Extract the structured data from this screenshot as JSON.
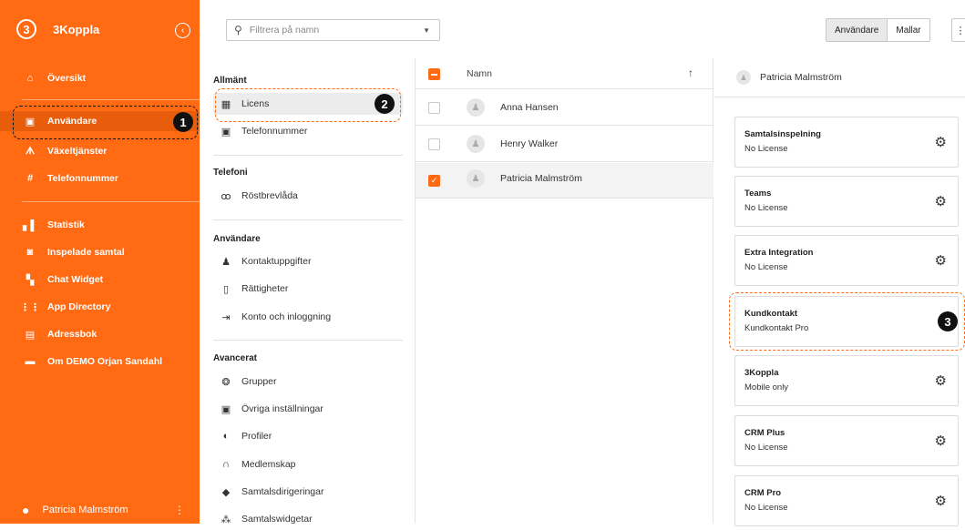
{
  "sidebar": {
    "app_title": "3Koppla",
    "logo_glyph": "3",
    "collapse_glyph": "‹",
    "items": [
      {
        "label": "Översikt",
        "icon": "home-icon",
        "glyph": "⌂"
      },
      {
        "label": "Användare",
        "icon": "user-card-icon",
        "glyph": "▣"
      },
      {
        "label": "Växeltjänster",
        "icon": "hierarchy-icon",
        "glyph": "ᗑ"
      },
      {
        "label": "Telefonnummer",
        "icon": "hash-icon",
        "glyph": "#"
      },
      {
        "label": "Statistik",
        "icon": "bar-chart-icon",
        "glyph": "▖▌"
      },
      {
        "label": "Inspelade samtal",
        "icon": "voicemail-icon",
        "glyph": "◙"
      },
      {
        "label": "Chat Widget",
        "icon": "widgets-icon",
        "glyph": "▚"
      },
      {
        "label": "App Directory",
        "icon": "grid-icon",
        "glyph": "⋮⋮"
      },
      {
        "label": "Adressbok",
        "icon": "contacts-icon",
        "glyph": "▤"
      },
      {
        "label": "Om DEMO Orjan Sandahl",
        "icon": "briefcase-icon",
        "glyph": "▬"
      }
    ],
    "user_name": "Patricia Malmström",
    "user_glyph": "●",
    "more_glyph": "⋮"
  },
  "topbar": {
    "search_placeholder": "Filtrera på namn",
    "search_glyph": "⚲",
    "dropdown_glyph": "▼",
    "toggle_users": "Användare",
    "toggle_templates": "Mallar",
    "kebab_glyph": "⋮"
  },
  "settings": {
    "sections": [
      {
        "title": "Allmänt",
        "items": [
          {
            "label": "Licens",
            "icon": "id-card-icon",
            "glyph": "▦"
          },
          {
            "label": "Telefonnummer",
            "icon": "dialpad-icon",
            "glyph": "▣"
          }
        ]
      },
      {
        "title": "Telefoni",
        "items": [
          {
            "label": "Röstbrevlåda",
            "icon": "voicemail-icon",
            "glyph": "ꝏ"
          }
        ]
      },
      {
        "title": "Användare",
        "items": [
          {
            "label": "Kontaktuppgifter",
            "icon": "person-icon",
            "glyph": "♟"
          },
          {
            "label": "Rättigheter",
            "icon": "clipboard-icon",
            "glyph": "▯"
          },
          {
            "label": "Konto och inloggning",
            "icon": "login-icon",
            "glyph": "⇥"
          }
        ]
      },
      {
        "title": "Avancerat",
        "items": [
          {
            "label": "Grupper",
            "icon": "group-icon",
            "glyph": "❂"
          },
          {
            "label": "Övriga inställningar",
            "icon": "settings-box-icon",
            "glyph": "▣"
          },
          {
            "label": "Profiler",
            "icon": "contrast-icon",
            "glyph": "◐"
          },
          {
            "label": "Medlemskap",
            "icon": "headset-icon",
            "glyph": "∩"
          },
          {
            "label": "Samtalsdirigeringar",
            "icon": "direction-icon",
            "glyph": "◆"
          },
          {
            "label": "Samtalswidgetar",
            "icon": "widget-icon",
            "glyph": "⁂"
          }
        ]
      }
    ]
  },
  "userlist": {
    "header": "Namn",
    "sort_glyph": "↑",
    "check_glyph": "✓",
    "avatar_glyph": "♟",
    "users": [
      {
        "name": "Anna Hansen",
        "checked": false
      },
      {
        "name": "Henry Walker",
        "checked": false
      },
      {
        "name": "Patricia Malmström",
        "checked": true
      }
    ]
  },
  "detail": {
    "user_name": "Patricia Malmström",
    "gear_glyph": "⚙",
    "licenses": [
      {
        "title": "Samtalsinspelning",
        "value": "No License"
      },
      {
        "title": "Teams",
        "value": "No License"
      },
      {
        "title": "Extra Integration",
        "value": "No License"
      },
      {
        "title": "Kundkontakt",
        "value": "Kundkontakt Pro"
      },
      {
        "title": "3Koppla",
        "value": "Mobile only"
      },
      {
        "title": "CRM Plus",
        "value": "No License"
      },
      {
        "title": "CRM Pro",
        "value": "No License"
      }
    ]
  },
  "callouts": [
    "1",
    "2",
    "3"
  ],
  "colors": {
    "accent": "#ff6a13",
    "accent_dark": "#e85d0c"
  }
}
